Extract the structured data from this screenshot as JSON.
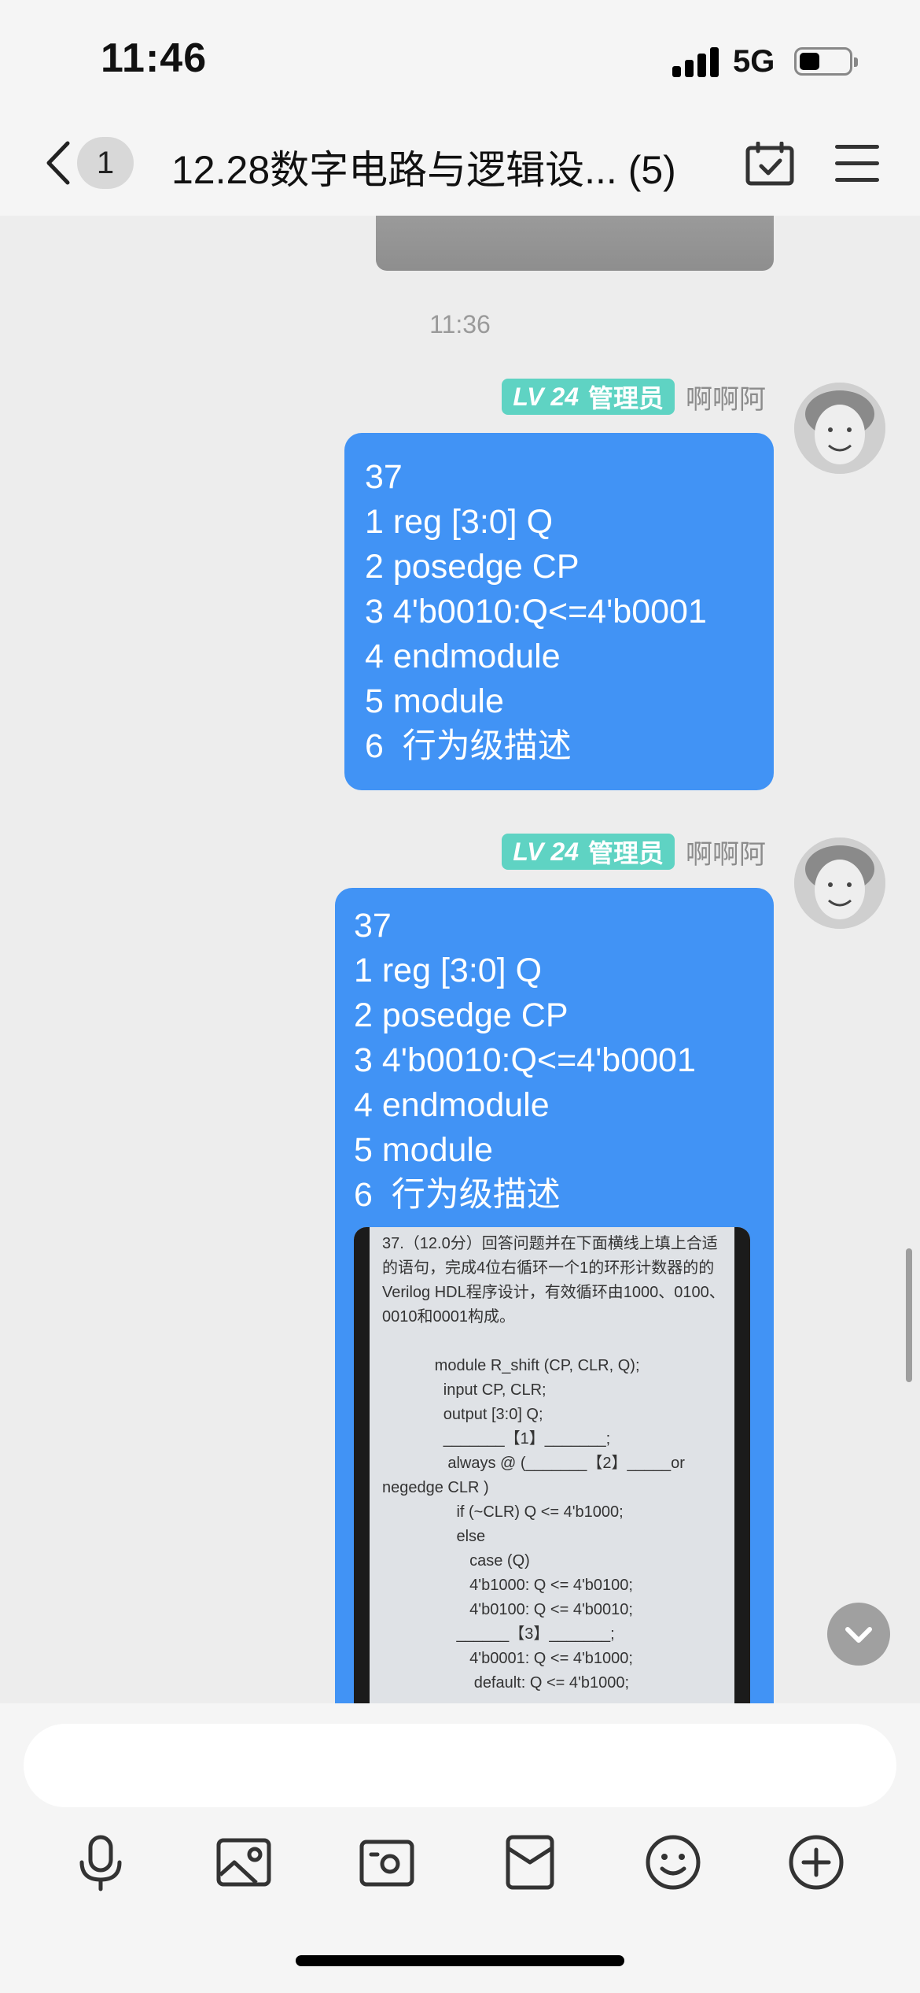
{
  "status_bar": {
    "time": "11:46",
    "network": "5G",
    "battery_level": 0.4
  },
  "nav": {
    "back_badge": "1",
    "title": "12.28数字电路与逻辑设... (5)"
  },
  "chat": {
    "timestamp": "11:36",
    "messages": [
      {
        "level_prefix": "LV",
        "level_num": "24",
        "role": "管理员",
        "sender": "啊啊阿",
        "text": "37\n1 reg [3:0] Q\n2 posedge CP\n3 4'b0010:Q<=4'b0001\n4 endmodule\n5 module\n6  行为级描述"
      },
      {
        "level_prefix": "LV",
        "level_num": "24",
        "role": "管理员",
        "sender": "啊啊阿",
        "text": "37\n1 reg [3:0] Q\n2 posedge CP\n3 4'b0010:Q<=4'b0001\n4 endmodule\n5 module\n6  行为级描述",
        "image_lines": [
          "37.（12.0分）回答问题并在下面横线上填上合适",
          "的语句，完成4位右循环一个1的环形计数器的的",
          "Verilog HDL程序设计，有效循环由1000、0100、",
          "0010和0001构成。",
          "",
          "            module R_shift (CP, CLR, Q);",
          "              input CP, CLR;",
          "              output [3:0] Q;",
          "              _______【1】_______;",
          "               always @ (_______【2】_____or",
          "negedge CLR )",
          "                 if (~CLR) Q <= 4'b1000;",
          "                 else",
          "                    case (Q)",
          "                    4'b1000: Q <= 4'b0100;",
          "                    4'b0100: Q <= 4'b0010;",
          "                 ______【3】_______;",
          "                    4'b0001: Q <= 4'b1000;",
          "                     default: Q <= 4'b1000;"
        ]
      }
    ]
  },
  "toolbar": {
    "icons": [
      "microphone-icon",
      "image-icon",
      "camera-icon",
      "red-packet-icon",
      "emoji-icon",
      "plus-icon"
    ]
  },
  "colors": {
    "bubble": "#4193f5",
    "level_badge": "#5fd3c3",
    "background": "#ededed"
  }
}
